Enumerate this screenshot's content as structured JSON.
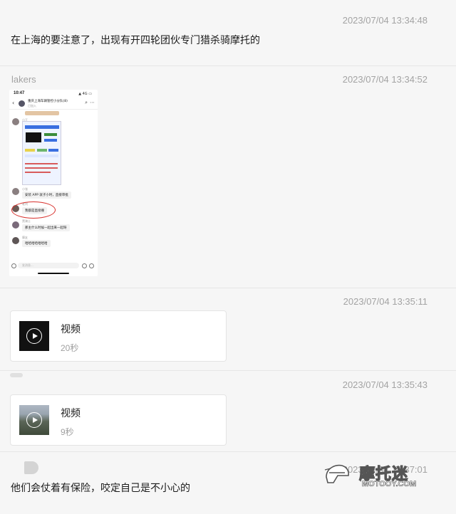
{
  "messages": [
    {
      "sender": "",
      "time": "2023/07/04 13:34:48",
      "text": "在上海的要注意了，出现有开四轮团伙专门猎杀骑摩托的"
    },
    {
      "sender": "lakers",
      "time": "2023/07/04 13:34:52",
      "type": "image"
    },
    {
      "sender": "",
      "time": "2023/07/04 13:35:11",
      "type": "video",
      "title": "视频",
      "duration": "20秒"
    },
    {
      "sender": "",
      "time": "2023/07/04 13:35:43",
      "type": "video",
      "title": "视频",
      "duration": "9秒"
    },
    {
      "sender": "",
      "time": "2023/07/04 13:37:01",
      "text": "他们会仗着有保险，咬定自己是不小心的"
    }
  ],
  "screenshot": {
    "status_time": "10:47",
    "status_icons": "▲ 4G ▭",
    "group_name": "重庆上海车辆管控小分队(8)",
    "group_sub": "已加入",
    "chat": [
      {
        "user": "小王",
        "text": ""
      },
      {
        "user": "小张",
        "text": "安装 APP 就子小时，直接审批"
      },
      {
        "user": "老刘",
        "text": "我都是直接撞"
      },
      {
        "user": "黑骑士",
        "text": "那主什么时候一起出来一起呀"
      },
      {
        "user": "摩友",
        "text": "哈哈哈哈哈哈哈"
      }
    ],
    "input_placeholder": "发消息..."
  },
  "watermark": {
    "chinese": "摩托迷",
    "english": "MOTOOY.COM"
  }
}
